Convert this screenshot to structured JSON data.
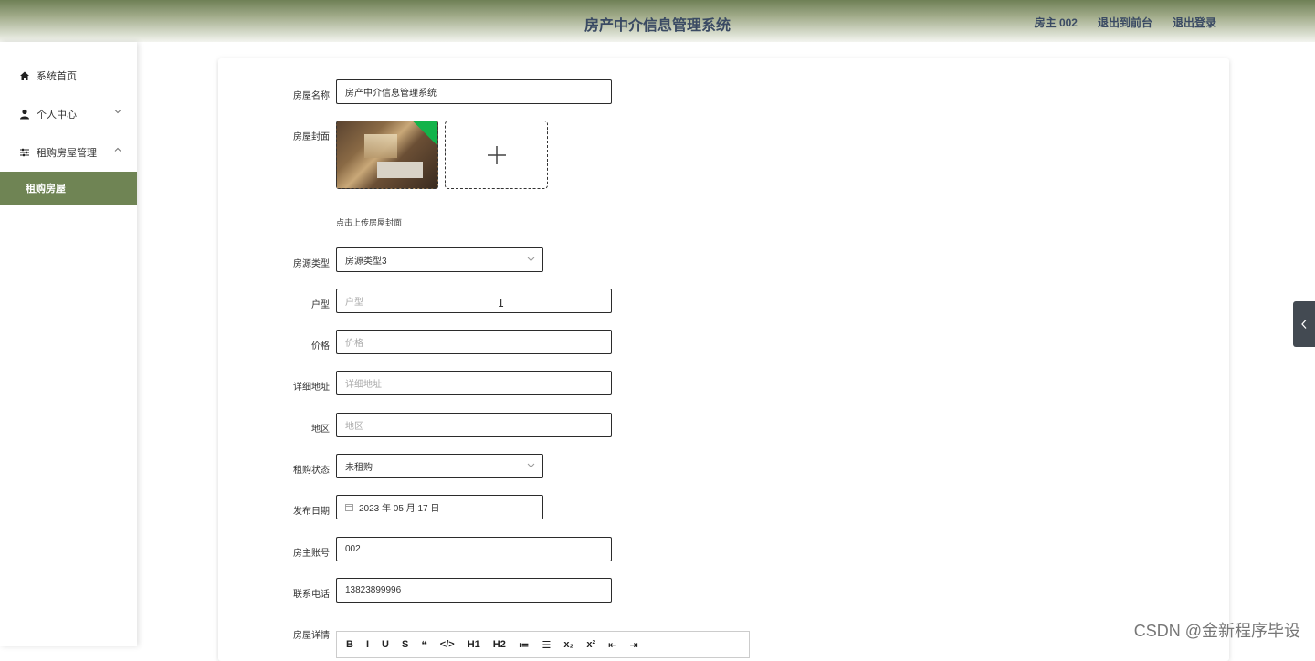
{
  "header": {
    "title": "房产中介信息管理系统",
    "user": "房主 002",
    "to_front": "退出到前台",
    "logout": "退出登录"
  },
  "sidebar": {
    "home": "系统首页",
    "personal": "个人中心",
    "rent_manage": "租购房屋管理",
    "rent_house": "租购房屋"
  },
  "form": {
    "name_label": "房屋名称",
    "name_value": "房产中介信息管理系统",
    "cover_label": "房屋封面",
    "cover_hint": "点击上传房屋封面",
    "type_label": "房源类型",
    "type_value": "房源类型3",
    "layout_label": "户型",
    "layout_placeholder": "户型",
    "price_label": "价格",
    "price_placeholder": "价格",
    "address_label": "详细地址",
    "address_placeholder": "详细地址",
    "region_label": "地区",
    "region_placeholder": "地区",
    "status_label": "租购状态",
    "status_value": "未租购",
    "date_label": "发布日期",
    "date_value": "2023 年 05 月 17 日",
    "owner_label": "房主账号",
    "owner_value": "002",
    "phone_label": "联系电话",
    "phone_value": "13823899996",
    "detail_label": "房屋详情"
  },
  "editor": {
    "buttons": [
      "B",
      "I",
      "U",
      "S",
      "❝",
      "</>",
      "H1",
      "H2",
      "≔",
      "☰",
      "x₂",
      "x²",
      "⇤",
      "⇥"
    ]
  },
  "watermark": "CSDN @金新程序毕设",
  "colors": {
    "accent": "#6f8454",
    "title": "#3a4a63",
    "upload_ok": "#13b34a"
  }
}
